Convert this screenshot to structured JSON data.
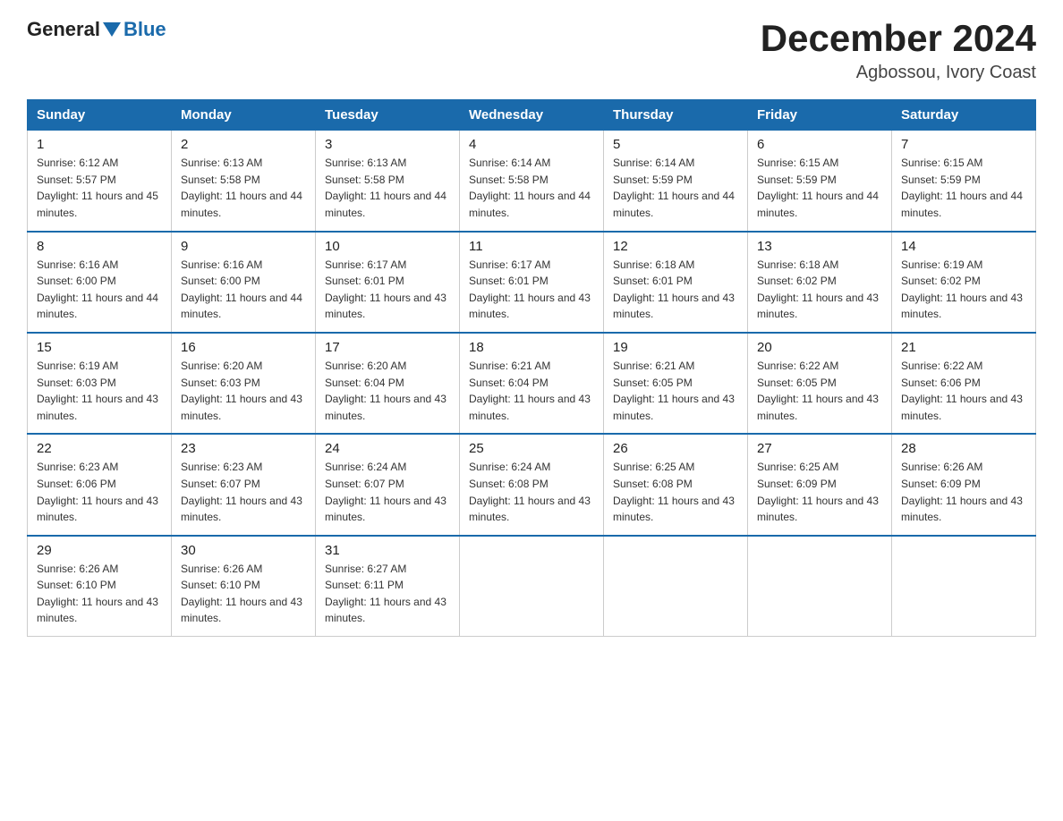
{
  "logo": {
    "general": "General",
    "blue": "Blue"
  },
  "header": {
    "month_title": "December 2024",
    "location": "Agbossou, Ivory Coast"
  },
  "days_of_week": [
    "Sunday",
    "Monday",
    "Tuesday",
    "Wednesday",
    "Thursday",
    "Friday",
    "Saturday"
  ],
  "weeks": [
    [
      {
        "day": "1",
        "sunrise": "6:12 AM",
        "sunset": "5:57 PM",
        "daylight": "11 hours and 45 minutes."
      },
      {
        "day": "2",
        "sunrise": "6:13 AM",
        "sunset": "5:58 PM",
        "daylight": "11 hours and 44 minutes."
      },
      {
        "day": "3",
        "sunrise": "6:13 AM",
        "sunset": "5:58 PM",
        "daylight": "11 hours and 44 minutes."
      },
      {
        "day": "4",
        "sunrise": "6:14 AM",
        "sunset": "5:58 PM",
        "daylight": "11 hours and 44 minutes."
      },
      {
        "day": "5",
        "sunrise": "6:14 AM",
        "sunset": "5:59 PM",
        "daylight": "11 hours and 44 minutes."
      },
      {
        "day": "6",
        "sunrise": "6:15 AM",
        "sunset": "5:59 PM",
        "daylight": "11 hours and 44 minutes."
      },
      {
        "day": "7",
        "sunrise": "6:15 AM",
        "sunset": "5:59 PM",
        "daylight": "11 hours and 44 minutes."
      }
    ],
    [
      {
        "day": "8",
        "sunrise": "6:16 AM",
        "sunset": "6:00 PM",
        "daylight": "11 hours and 44 minutes."
      },
      {
        "day": "9",
        "sunrise": "6:16 AM",
        "sunset": "6:00 PM",
        "daylight": "11 hours and 44 minutes."
      },
      {
        "day": "10",
        "sunrise": "6:17 AM",
        "sunset": "6:01 PM",
        "daylight": "11 hours and 43 minutes."
      },
      {
        "day": "11",
        "sunrise": "6:17 AM",
        "sunset": "6:01 PM",
        "daylight": "11 hours and 43 minutes."
      },
      {
        "day": "12",
        "sunrise": "6:18 AM",
        "sunset": "6:01 PM",
        "daylight": "11 hours and 43 minutes."
      },
      {
        "day": "13",
        "sunrise": "6:18 AM",
        "sunset": "6:02 PM",
        "daylight": "11 hours and 43 minutes."
      },
      {
        "day": "14",
        "sunrise": "6:19 AM",
        "sunset": "6:02 PM",
        "daylight": "11 hours and 43 minutes."
      }
    ],
    [
      {
        "day": "15",
        "sunrise": "6:19 AM",
        "sunset": "6:03 PM",
        "daylight": "11 hours and 43 minutes."
      },
      {
        "day": "16",
        "sunrise": "6:20 AM",
        "sunset": "6:03 PM",
        "daylight": "11 hours and 43 minutes."
      },
      {
        "day": "17",
        "sunrise": "6:20 AM",
        "sunset": "6:04 PM",
        "daylight": "11 hours and 43 minutes."
      },
      {
        "day": "18",
        "sunrise": "6:21 AM",
        "sunset": "6:04 PM",
        "daylight": "11 hours and 43 minutes."
      },
      {
        "day": "19",
        "sunrise": "6:21 AM",
        "sunset": "6:05 PM",
        "daylight": "11 hours and 43 minutes."
      },
      {
        "day": "20",
        "sunrise": "6:22 AM",
        "sunset": "6:05 PM",
        "daylight": "11 hours and 43 minutes."
      },
      {
        "day": "21",
        "sunrise": "6:22 AM",
        "sunset": "6:06 PM",
        "daylight": "11 hours and 43 minutes."
      }
    ],
    [
      {
        "day": "22",
        "sunrise": "6:23 AM",
        "sunset": "6:06 PM",
        "daylight": "11 hours and 43 minutes."
      },
      {
        "day": "23",
        "sunrise": "6:23 AM",
        "sunset": "6:07 PM",
        "daylight": "11 hours and 43 minutes."
      },
      {
        "day": "24",
        "sunrise": "6:24 AM",
        "sunset": "6:07 PM",
        "daylight": "11 hours and 43 minutes."
      },
      {
        "day": "25",
        "sunrise": "6:24 AM",
        "sunset": "6:08 PM",
        "daylight": "11 hours and 43 minutes."
      },
      {
        "day": "26",
        "sunrise": "6:25 AM",
        "sunset": "6:08 PM",
        "daylight": "11 hours and 43 minutes."
      },
      {
        "day": "27",
        "sunrise": "6:25 AM",
        "sunset": "6:09 PM",
        "daylight": "11 hours and 43 minutes."
      },
      {
        "day": "28",
        "sunrise": "6:26 AM",
        "sunset": "6:09 PM",
        "daylight": "11 hours and 43 minutes."
      }
    ],
    [
      {
        "day": "29",
        "sunrise": "6:26 AM",
        "sunset": "6:10 PM",
        "daylight": "11 hours and 43 minutes."
      },
      {
        "day": "30",
        "sunrise": "6:26 AM",
        "sunset": "6:10 PM",
        "daylight": "11 hours and 43 minutes."
      },
      {
        "day": "31",
        "sunrise": "6:27 AM",
        "sunset": "6:11 PM",
        "daylight": "11 hours and 43 minutes."
      },
      null,
      null,
      null,
      null
    ]
  ]
}
